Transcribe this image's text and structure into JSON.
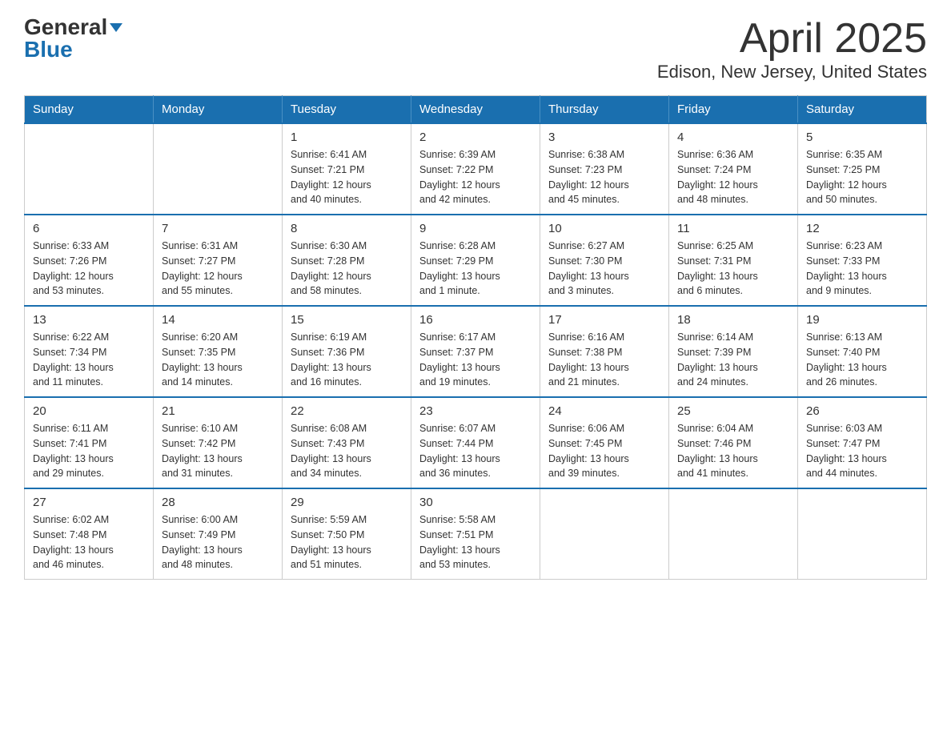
{
  "logo": {
    "general": "General",
    "blue": "Blue",
    "arrow": "▼"
  },
  "title": "April 2025",
  "subtitle": "Edison, New Jersey, United States",
  "calendar": {
    "headers": [
      "Sunday",
      "Monday",
      "Tuesday",
      "Wednesday",
      "Thursday",
      "Friday",
      "Saturday"
    ],
    "weeks": [
      [
        {
          "day": "",
          "info": ""
        },
        {
          "day": "",
          "info": ""
        },
        {
          "day": "1",
          "info": "Sunrise: 6:41 AM\nSunset: 7:21 PM\nDaylight: 12 hours\nand 40 minutes."
        },
        {
          "day": "2",
          "info": "Sunrise: 6:39 AM\nSunset: 7:22 PM\nDaylight: 12 hours\nand 42 minutes."
        },
        {
          "day": "3",
          "info": "Sunrise: 6:38 AM\nSunset: 7:23 PM\nDaylight: 12 hours\nand 45 minutes."
        },
        {
          "day": "4",
          "info": "Sunrise: 6:36 AM\nSunset: 7:24 PM\nDaylight: 12 hours\nand 48 minutes."
        },
        {
          "day": "5",
          "info": "Sunrise: 6:35 AM\nSunset: 7:25 PM\nDaylight: 12 hours\nand 50 minutes."
        }
      ],
      [
        {
          "day": "6",
          "info": "Sunrise: 6:33 AM\nSunset: 7:26 PM\nDaylight: 12 hours\nand 53 minutes."
        },
        {
          "day": "7",
          "info": "Sunrise: 6:31 AM\nSunset: 7:27 PM\nDaylight: 12 hours\nand 55 minutes."
        },
        {
          "day": "8",
          "info": "Sunrise: 6:30 AM\nSunset: 7:28 PM\nDaylight: 12 hours\nand 58 minutes."
        },
        {
          "day": "9",
          "info": "Sunrise: 6:28 AM\nSunset: 7:29 PM\nDaylight: 13 hours\nand 1 minute."
        },
        {
          "day": "10",
          "info": "Sunrise: 6:27 AM\nSunset: 7:30 PM\nDaylight: 13 hours\nand 3 minutes."
        },
        {
          "day": "11",
          "info": "Sunrise: 6:25 AM\nSunset: 7:31 PM\nDaylight: 13 hours\nand 6 minutes."
        },
        {
          "day": "12",
          "info": "Sunrise: 6:23 AM\nSunset: 7:33 PM\nDaylight: 13 hours\nand 9 minutes."
        }
      ],
      [
        {
          "day": "13",
          "info": "Sunrise: 6:22 AM\nSunset: 7:34 PM\nDaylight: 13 hours\nand 11 minutes."
        },
        {
          "day": "14",
          "info": "Sunrise: 6:20 AM\nSunset: 7:35 PM\nDaylight: 13 hours\nand 14 minutes."
        },
        {
          "day": "15",
          "info": "Sunrise: 6:19 AM\nSunset: 7:36 PM\nDaylight: 13 hours\nand 16 minutes."
        },
        {
          "day": "16",
          "info": "Sunrise: 6:17 AM\nSunset: 7:37 PM\nDaylight: 13 hours\nand 19 minutes."
        },
        {
          "day": "17",
          "info": "Sunrise: 6:16 AM\nSunset: 7:38 PM\nDaylight: 13 hours\nand 21 minutes."
        },
        {
          "day": "18",
          "info": "Sunrise: 6:14 AM\nSunset: 7:39 PM\nDaylight: 13 hours\nand 24 minutes."
        },
        {
          "day": "19",
          "info": "Sunrise: 6:13 AM\nSunset: 7:40 PM\nDaylight: 13 hours\nand 26 minutes."
        }
      ],
      [
        {
          "day": "20",
          "info": "Sunrise: 6:11 AM\nSunset: 7:41 PM\nDaylight: 13 hours\nand 29 minutes."
        },
        {
          "day": "21",
          "info": "Sunrise: 6:10 AM\nSunset: 7:42 PM\nDaylight: 13 hours\nand 31 minutes."
        },
        {
          "day": "22",
          "info": "Sunrise: 6:08 AM\nSunset: 7:43 PM\nDaylight: 13 hours\nand 34 minutes."
        },
        {
          "day": "23",
          "info": "Sunrise: 6:07 AM\nSunset: 7:44 PM\nDaylight: 13 hours\nand 36 minutes."
        },
        {
          "day": "24",
          "info": "Sunrise: 6:06 AM\nSunset: 7:45 PM\nDaylight: 13 hours\nand 39 minutes."
        },
        {
          "day": "25",
          "info": "Sunrise: 6:04 AM\nSunset: 7:46 PM\nDaylight: 13 hours\nand 41 minutes."
        },
        {
          "day": "26",
          "info": "Sunrise: 6:03 AM\nSunset: 7:47 PM\nDaylight: 13 hours\nand 44 minutes."
        }
      ],
      [
        {
          "day": "27",
          "info": "Sunrise: 6:02 AM\nSunset: 7:48 PM\nDaylight: 13 hours\nand 46 minutes."
        },
        {
          "day": "28",
          "info": "Sunrise: 6:00 AM\nSunset: 7:49 PM\nDaylight: 13 hours\nand 48 minutes."
        },
        {
          "day": "29",
          "info": "Sunrise: 5:59 AM\nSunset: 7:50 PM\nDaylight: 13 hours\nand 51 minutes."
        },
        {
          "day": "30",
          "info": "Sunrise: 5:58 AM\nSunset: 7:51 PM\nDaylight: 13 hours\nand 53 minutes."
        },
        {
          "day": "",
          "info": ""
        },
        {
          "day": "",
          "info": ""
        },
        {
          "day": "",
          "info": ""
        }
      ]
    ]
  }
}
